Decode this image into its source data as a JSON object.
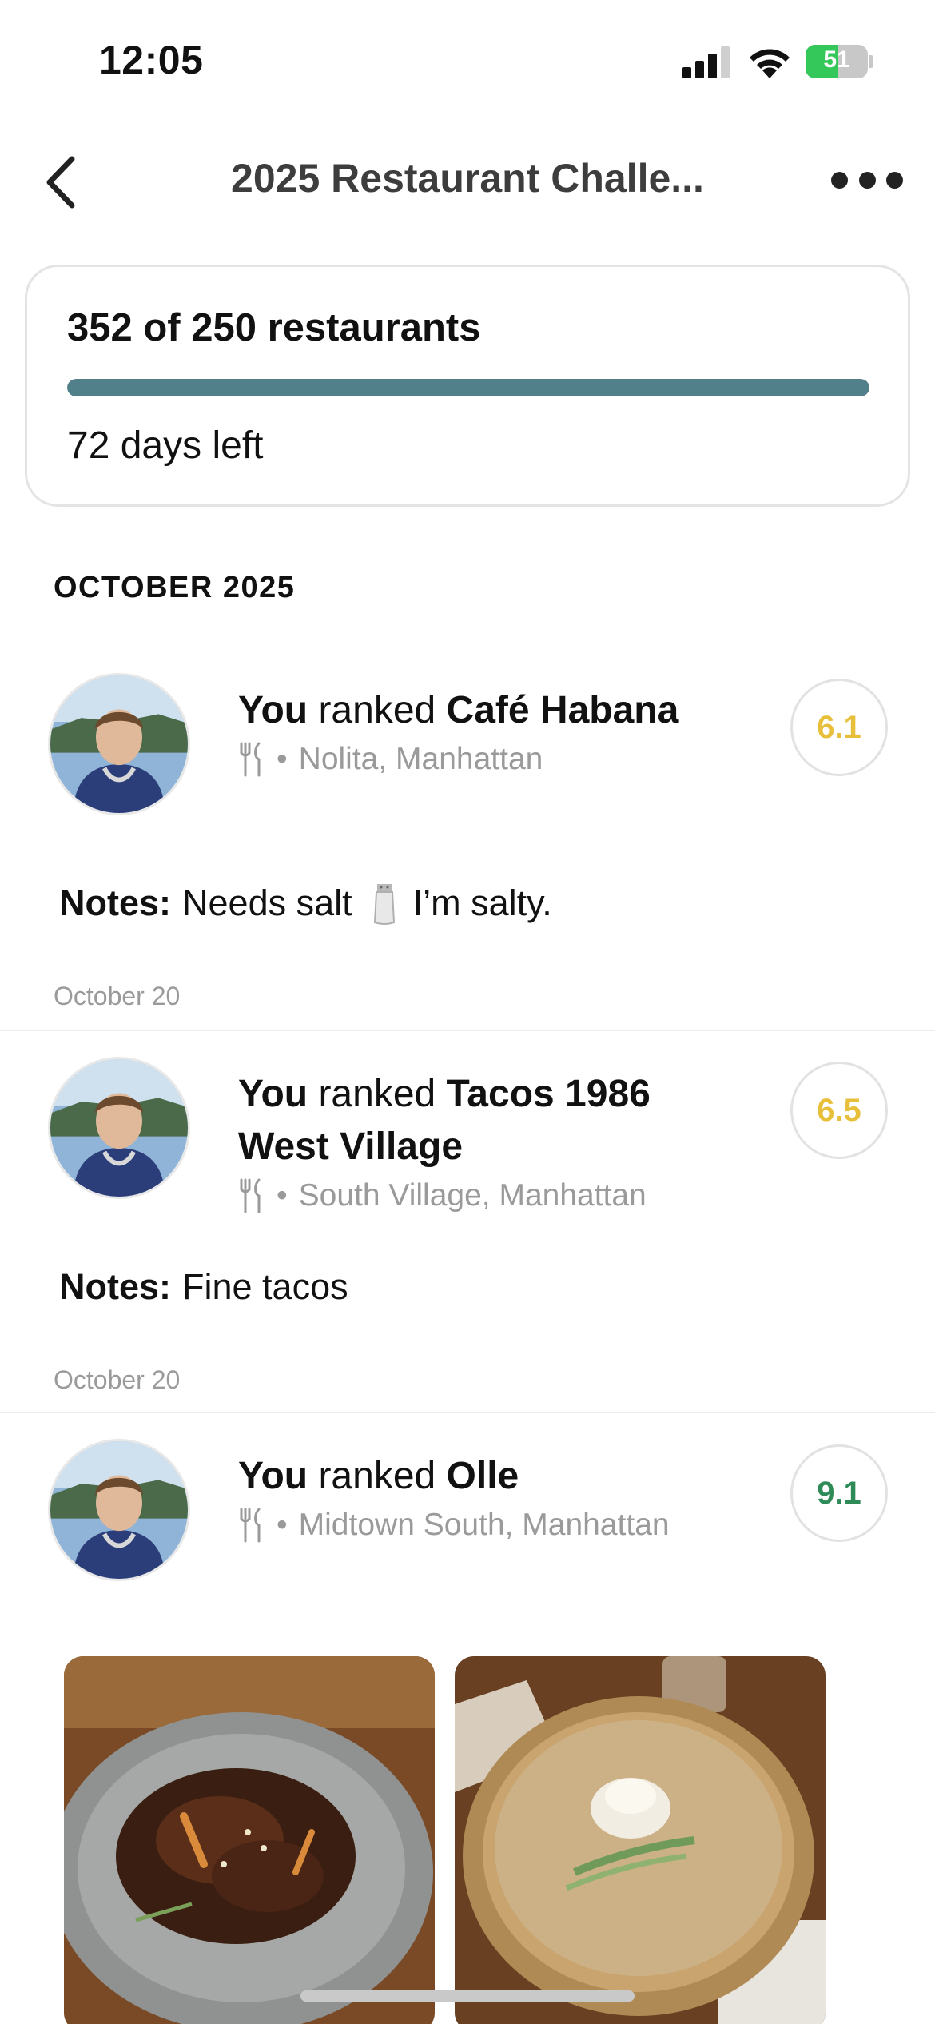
{
  "status_bar": {
    "time": "12:05",
    "battery_percent": 51,
    "battery_label": "51",
    "battery_color": "#34c759"
  },
  "nav": {
    "title": "2025 Restaurant Challe...",
    "back_icon": "chevron-left-icon",
    "more_icon": "ellipsis-icon"
  },
  "challenge": {
    "progress_label": "352 of 250 restaurants",
    "progress_fraction": 1.0,
    "days_left": "72 days left",
    "accent_color": "#52808a"
  },
  "section": {
    "header": "OCTOBER 2025"
  },
  "feed": [
    {
      "actor": "You",
      "verb": "ranked",
      "restaurant": "Café Habana",
      "location": "Nolita, Manhattan",
      "score": "6.1",
      "score_color": "#e8bf3a",
      "notes_label": "Notes:",
      "notes_before": "Needs salt",
      "notes_emoji": "salt-shaker-icon",
      "notes_after": "I’m salty.",
      "date": "October 20"
    },
    {
      "actor": "You",
      "verb": "ranked",
      "restaurant": "Tacos 1986 West Village",
      "location": "South Village, Manhattan",
      "score": "6.5",
      "score_color": "#e8bf3a",
      "notes_label": "Notes:",
      "notes_text": "Fine tacos",
      "date": "October 20"
    },
    {
      "actor": "You",
      "verb": "ranked",
      "restaurant": "Olle",
      "location": "Midtown South, Manhattan",
      "score": "9.1",
      "score_color": "#2e8b57"
    }
  ],
  "meta_separator": "•"
}
